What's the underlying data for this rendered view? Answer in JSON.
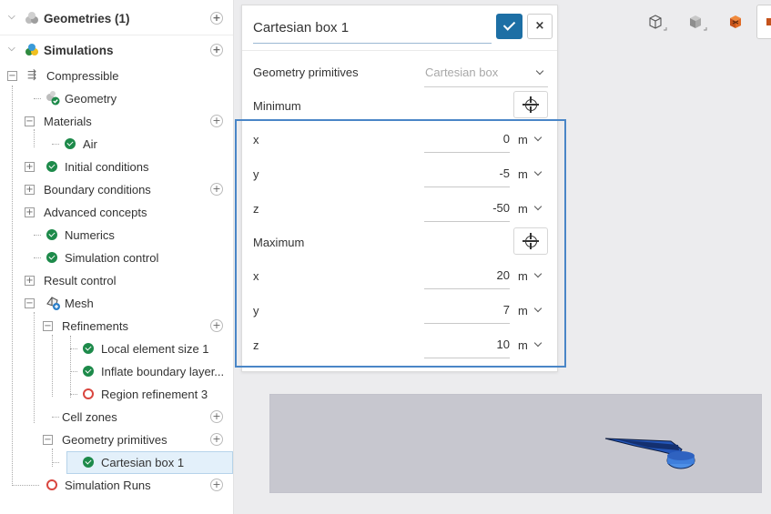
{
  "tree": {
    "geometries": {
      "label": "Geometries (1)"
    },
    "simulations": {
      "label": "Simulations"
    },
    "items": [
      {
        "label": "Compressible"
      },
      {
        "label": "Geometry"
      },
      {
        "label": "Materials"
      },
      {
        "label": "Air"
      },
      {
        "label": "Initial conditions"
      },
      {
        "label": "Boundary conditions"
      },
      {
        "label": "Advanced concepts"
      },
      {
        "label": "Numerics"
      },
      {
        "label": "Simulation control"
      },
      {
        "label": "Result control"
      },
      {
        "label": "Mesh"
      },
      {
        "label": "Refinements"
      },
      {
        "label": "Local element size 1"
      },
      {
        "label": "Inflate boundary layer..."
      },
      {
        "label": "Region refinement 3"
      },
      {
        "label": "Cell zones"
      },
      {
        "label": "Geometry primitives"
      },
      {
        "label": "Cartesian box 1"
      },
      {
        "label": "Simulation Runs"
      }
    ]
  },
  "dialog": {
    "title": "Cartesian box 1",
    "close_label": "×",
    "geometry_primitives": {
      "label": "Geometry primitives",
      "value": "Cartesian box"
    },
    "minimum": {
      "label": "Minimum",
      "x": {
        "label": "x",
        "value": "0",
        "unit": "m"
      },
      "y": {
        "label": "y",
        "value": "-5",
        "unit": "m"
      },
      "z": {
        "label": "z",
        "value": "-50",
        "unit": "m"
      }
    },
    "maximum": {
      "label": "Maximum",
      "x": {
        "label": "x",
        "value": "20",
        "unit": "m"
      },
      "y": {
        "label": "y",
        "value": "7",
        "unit": "m"
      },
      "z": {
        "label": "z",
        "value": "10",
        "unit": "m"
      }
    }
  },
  "colors": {
    "accent": "#1d6fa5",
    "success": "#1d8a4a",
    "error": "#d9463f",
    "highlight_box": "#4a86c7",
    "model": "#1f4fa0"
  },
  "icons": [
    "chevron-down-icon",
    "chevron-right-icon",
    "expand-minus-icon",
    "expand-plus-icon",
    "check-circle-icon",
    "error-ring-icon",
    "add-circle-icon",
    "crosshair-icon",
    "wireframe-cube-icon",
    "solid-cube-icon",
    "orange-cube-icon"
  ]
}
